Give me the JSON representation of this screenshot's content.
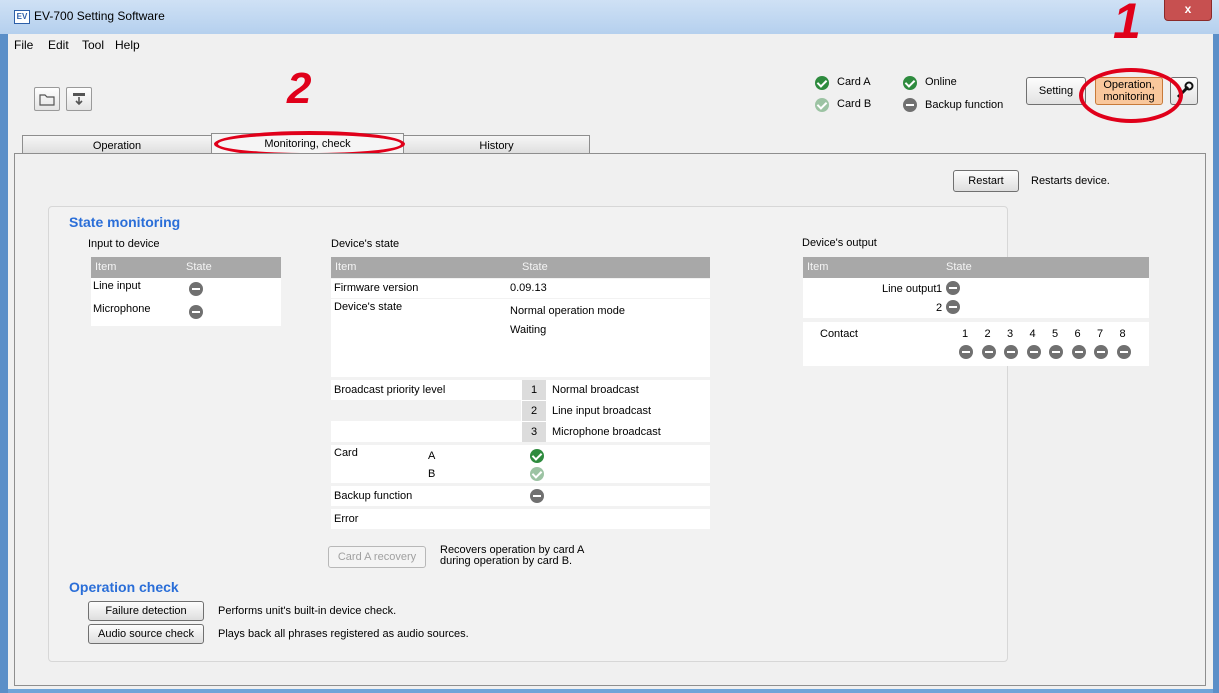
{
  "window": {
    "title": "EV-700 Setting Software",
    "app_icon_text": "EV",
    "close_glyph": "x"
  },
  "menu": [
    "File",
    "Edit",
    "Tool",
    "Help"
  ],
  "status": {
    "card_a": "Card A",
    "card_b": "Card B",
    "online": "Online",
    "backup": "Backup function"
  },
  "mode_buttons": {
    "setting": "Setting",
    "operation": "Operation,",
    "operation2": "monitoring"
  },
  "tabs": [
    "Operation",
    "Monitoring, check",
    "History"
  ],
  "callouts": {
    "one": "1",
    "two": "2"
  },
  "restart": {
    "label": "Restart",
    "desc": "Restarts device."
  },
  "state_monitoring": {
    "title": "State monitoring",
    "input": {
      "title": "Input to device",
      "col_item": "Item",
      "col_state": "State",
      "rows": [
        "Line input",
        "Microphone"
      ]
    },
    "device": {
      "title": "Device's state",
      "col_item": "Item",
      "col_state": "State",
      "firmware_label": "Firmware version",
      "firmware_value": "0.09.13",
      "state_label": "Device's state",
      "state_value1": "Normal operation mode",
      "state_value2": "Waiting",
      "priority_label": "Broadcast priority level",
      "priorities": [
        {
          "num": "1",
          "label": "Normal broadcast"
        },
        {
          "num": "2",
          "label": "Line input broadcast"
        },
        {
          "num": "3",
          "label": "Microphone broadcast"
        }
      ],
      "card_label": "Card",
      "card_a": "A",
      "card_b": "B",
      "backup_label": "Backup function",
      "error_label": "Error"
    },
    "recovery": {
      "label": "Card A recovery",
      "desc1": "Recovers operation by card A",
      "desc2": "during operation by card B."
    },
    "output": {
      "title": "Device's output",
      "col_item": "Item",
      "col_state": "State",
      "line_output": "Line output",
      "line_1": "1",
      "line_2": "2",
      "contact": "Contact",
      "contact_nums": [
        "1",
        "2",
        "3",
        "4",
        "5",
        "6",
        "7",
        "8"
      ]
    }
  },
  "operation_check": {
    "title": "Operation check",
    "failure_btn": "Failure detection",
    "failure_desc": "Performs unit's built-in device check.",
    "audio_btn": "Audio source check",
    "audio_desc": "Plays back all phrases registered as audio sources."
  },
  "colors": {
    "accent_heading": "#2a6ed8",
    "callout_red": "#e0001a",
    "ok_green": "#2e8b3e",
    "operation_btn": "#f9c79c"
  }
}
